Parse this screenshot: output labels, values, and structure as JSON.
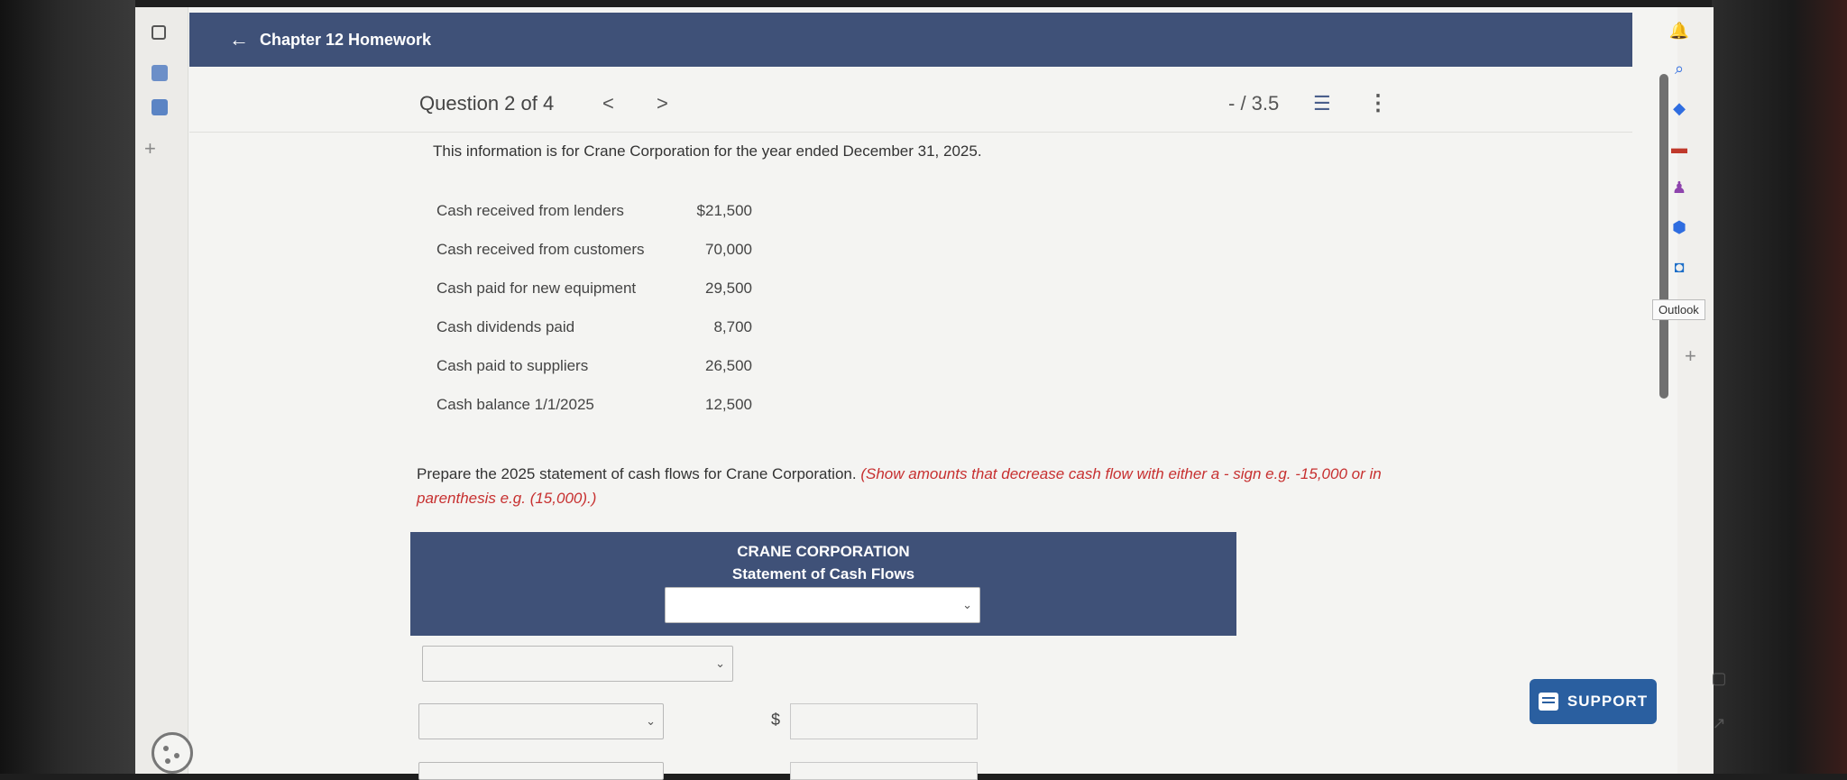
{
  "header": {
    "title": "Chapter 12 Homework"
  },
  "question_nav": {
    "counter": "Question 2 of 4",
    "prev": "<",
    "next": ">",
    "score": "- / 3.5",
    "more": "⋮"
  },
  "intro": "This information is for Crane Corporation for the year ended December 31, 2025.",
  "items": [
    {
      "label": "Cash received from lenders",
      "value": "$21,500"
    },
    {
      "label": "Cash received from customers",
      "value": "70,000"
    },
    {
      "label": "Cash paid for new equipment",
      "value": "29,500"
    },
    {
      "label": "Cash dividends paid",
      "value": "8,700"
    },
    {
      "label": "Cash paid to suppliers",
      "value": "26,500"
    },
    {
      "label": "Cash balance 1/1/2025",
      "value": "12,500"
    }
  ],
  "instruction": {
    "main": "Prepare the 2025 statement of cash flows for Crane Corporation.",
    "hint": "(Show amounts that decrease cash flow with either a - sign e.g. -15,000 or in parenthesis e.g. (15,000).)"
  },
  "statement": {
    "company": "CRANE CORPORATION",
    "title": "Statement of Cash Flows"
  },
  "currency": "$",
  "support": {
    "label": "SUPPORT"
  },
  "sidebar": {
    "outlook_tooltip": "Outlook"
  },
  "colors": {
    "header_bg": "#3f5178",
    "support_bg": "#2a5fa0",
    "hint_red": "#c73030"
  }
}
